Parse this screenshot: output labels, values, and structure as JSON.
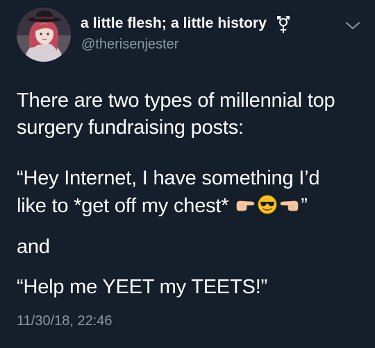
{
  "tweet": {
    "display_name": "a little flesh; a little history",
    "handle": "@therisenjester",
    "lines": [
      "There are two types of millennial top",
      "surgery fundraising posts:",
      "“Hey Internet, I have something I’d",
      "like to *get off my chest*",
      "”",
      "and",
      "“Help me YEET my TEETS!”"
    ],
    "timestamp": "11/30/18, 22:46"
  },
  "icons": {
    "gender": "transgender-symbol-icon",
    "menu": "chevron-down-icon",
    "emoji_left": "backhand-index-pointing-right-emoji",
    "emoji_middle": "smiling-face-with-sunglasses-emoji",
    "emoji_right": "backhand-index-pointing-left-emoji"
  },
  "colors": {
    "background": "#151f2b",
    "primary_text": "#ffffff",
    "secondary_text": "#8899a6"
  }
}
